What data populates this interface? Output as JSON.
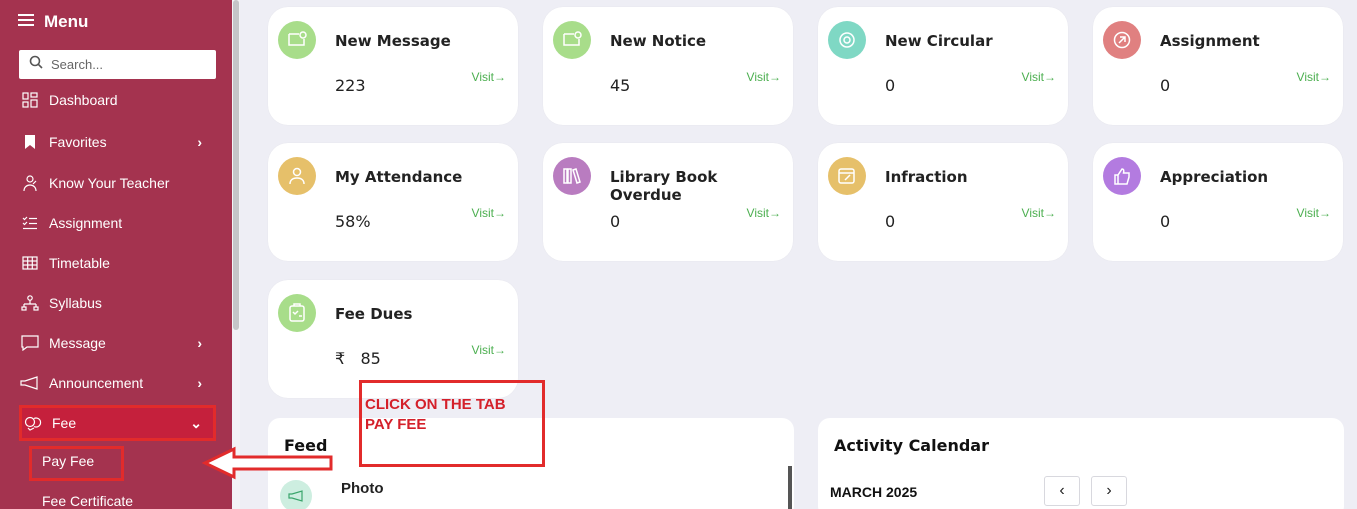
{
  "sidebar": {
    "menu_label": "Menu",
    "search_placeholder": "Search...",
    "items": [
      {
        "label": "Dashboard",
        "icon": "dashboard-icon"
      },
      {
        "label": "Favorites",
        "icon": "bookmark-icon"
      },
      {
        "label": "Know Your Teacher",
        "icon": "teacher-icon"
      },
      {
        "label": "Assignment",
        "icon": "list-check-icon"
      },
      {
        "label": "Timetable",
        "icon": "grid-icon"
      },
      {
        "label": "Syllabus",
        "icon": "sitemap-icon"
      },
      {
        "label": "Message",
        "icon": "chat-icon"
      },
      {
        "label": "Announcement",
        "icon": "megaphone-icon"
      },
      {
        "label": "Fee",
        "icon": "coins-icon"
      }
    ],
    "sub_items": [
      {
        "label": "Pay Fee"
      },
      {
        "label": "Fee Certificate"
      }
    ]
  },
  "cards": [
    {
      "title": "New Message",
      "value": "223",
      "visit": "Visit",
      "color": "#a8dd8a"
    },
    {
      "title": "New Notice",
      "value": "45",
      "visit": "Visit",
      "color": "#a8dd8a"
    },
    {
      "title": "New Circular",
      "value": "0",
      "visit": "Visit",
      "color": "#7fd8c4"
    },
    {
      "title": "Assignment",
      "value": "0",
      "visit": "Visit",
      "color": "#e08080"
    },
    {
      "title": "My Attendance",
      "value": "58%",
      "visit": "Visit",
      "color": "#e6c06a"
    },
    {
      "title": "Library Book Overdue",
      "value": "0",
      "visit": "Visit",
      "color": "#b97cc0"
    },
    {
      "title": "Infraction",
      "value": "0",
      "visit": "Visit",
      "color": "#e6c06a"
    },
    {
      "title": "Appreciation",
      "value": "0",
      "visit": "Visit",
      "color": "#b37be0"
    },
    {
      "title": "Fee Dues",
      "value": "₹   85",
      "visit": "Visit",
      "color": "#a8dd8a"
    }
  ],
  "annotation": {
    "line1": "CLICK ON THE TAB",
    "line2": "PAY FEE"
  },
  "feed": {
    "title": "Feed",
    "item_title": "Photo"
  },
  "activity": {
    "title": "Activity Calendar",
    "month": "MARCH 2025",
    "prev": "‹",
    "next": "›"
  },
  "colors": {
    "sidebar": "#a4334f",
    "active": "#c5203c",
    "annotation": "#e22b2b",
    "visit": "#4caf50"
  }
}
